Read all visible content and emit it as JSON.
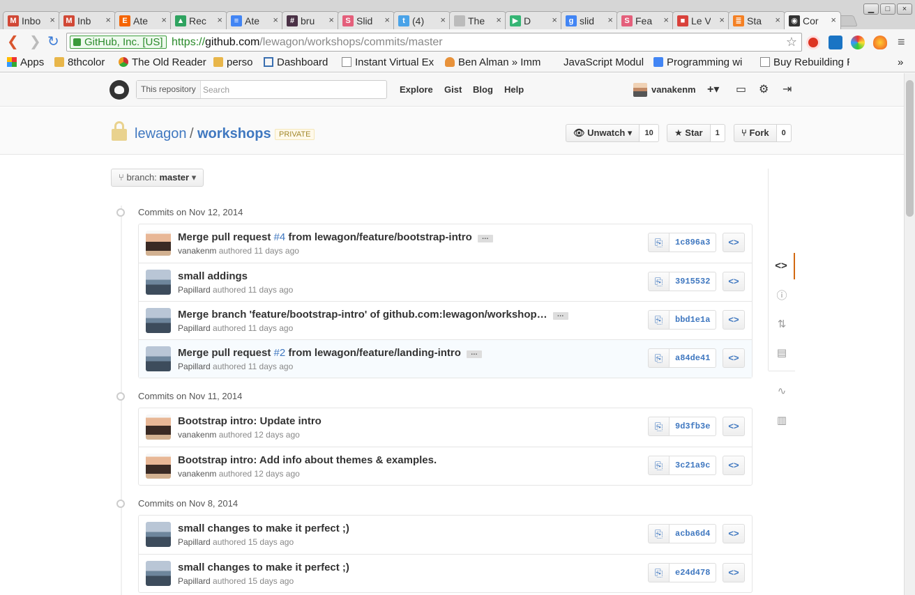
{
  "browser": {
    "tabs": [
      {
        "title": "Inbo",
        "favicon": "gmail-icon",
        "color": "#d14836",
        "glyph": "M"
      },
      {
        "title": "Inb",
        "favicon": "gmail-icon",
        "color": "#d14836",
        "glyph": "M"
      },
      {
        "title": "Ate",
        "favicon": "etsy-icon",
        "color": "#f56400",
        "glyph": "E"
      },
      {
        "title": "Rec",
        "favicon": "drive-icon",
        "color": "#2fa360",
        "glyph": "▲"
      },
      {
        "title": "Ate",
        "favicon": "docs-icon",
        "color": "#4285f4",
        "glyph": "≡"
      },
      {
        "title": "bru",
        "favicon": "slack-icon",
        "color": "#4a3146",
        "glyph": "#"
      },
      {
        "title": "Slid",
        "favicon": "slides-s-icon",
        "color": "#e45f7b",
        "glyph": "S"
      },
      {
        "title": "(4)",
        "favicon": "twitter-icon",
        "color": "#4aa3e8",
        "glyph": "t"
      },
      {
        "title": "The",
        "favicon": "page-icon",
        "color": "#bbbbbb",
        "glyph": ""
      },
      {
        "title": "D",
        "favicon": "play-icon",
        "color": "#35b574",
        "glyph": "▶"
      },
      {
        "title": "slid",
        "favicon": "google-icon",
        "color": "#4285f4",
        "glyph": "g"
      },
      {
        "title": "Fea",
        "favicon": "slides-s-icon",
        "color": "#e45f7b",
        "glyph": "S"
      },
      {
        "title": "Le V",
        "favicon": "wagon-icon",
        "color": "#d9413b",
        "glyph": "■"
      },
      {
        "title": "Sta",
        "favicon": "stack-icon",
        "color": "#f48024",
        "glyph": "≣"
      },
      {
        "title": "Cor",
        "favicon": "github-icon",
        "color": "#333333",
        "glyph": "◉"
      }
    ],
    "ev_label": "GitHub, Inc. [US]",
    "url_scheme": "https://",
    "url_host": "github.com",
    "url_path": "/lewagon/workshops/commits/master",
    "bookmarks": [
      {
        "label": "Apps",
        "icon": "apps-grid-icon"
      },
      {
        "label": "8thcolor",
        "icon": "folder-icon"
      },
      {
        "label": "The Old Reader",
        "icon": "oldreader-icon"
      },
      {
        "label": "perso",
        "icon": "folder-icon"
      },
      {
        "label": "Dashboard",
        "icon": "dashboard-icon"
      },
      {
        "label": "Instant Virtual Ex",
        "icon": "page-icon"
      },
      {
        "label": "Ben Alman » Imm",
        "icon": "ben-icon"
      },
      {
        "label": "JavaScript Modul",
        "icon": "none"
      },
      {
        "label": "Programming wi",
        "icon": "google-icon"
      },
      {
        "label": "Buy Rebuilding R",
        "icon": "page-icon"
      }
    ],
    "bookmarks_more": "»"
  },
  "github": {
    "search_scope": "This repository",
    "search_placeholder": "Search",
    "nav": [
      "Explore",
      "Gist",
      "Blog",
      "Help"
    ],
    "username": "vanakenm",
    "plus_label": "+▾"
  },
  "repo": {
    "owner": "lewagon",
    "slash": "/",
    "name": "workshops",
    "visibility": "PRIVATE",
    "unwatch_label": "Unwatch ▾",
    "watch_count": "10",
    "star_label": "Star",
    "star_count": "1",
    "fork_label": "Fork",
    "fork_count": "0"
  },
  "branch": {
    "label": "branch:",
    "name": "master"
  },
  "commit_days": [
    {
      "title": "Commits on Nov 12, 2014",
      "commits": [
        {
          "pre": "Merge pull request ",
          "pr": "#4",
          "post": " from lewagon/feature/bootstrap-intro",
          "ellipsis": true,
          "author": "vanakenm",
          "avatar": "v",
          "time": "authored 11 days ago",
          "sha": "1c896a3"
        },
        {
          "pre": "small addings",
          "pr": "",
          "post": "",
          "ellipsis": false,
          "author": "Papillard",
          "avatar": "p",
          "time": "authored 11 days ago",
          "sha": "3915532"
        },
        {
          "pre": "Merge branch 'feature/bootstrap-intro' of github.com:lewagon/workshop…",
          "pr": "",
          "post": "",
          "ellipsis": true,
          "author": "Papillard",
          "avatar": "p",
          "time": "authored 11 days ago",
          "sha": "bbd1e1a"
        },
        {
          "pre": "Merge pull request ",
          "pr": "#2",
          "post": " from lewagon/feature/landing-intro",
          "ellipsis": true,
          "author": "Papillard",
          "avatar": "p",
          "time": "authored 11 days ago",
          "sha": "a84de41",
          "highlighted": true
        }
      ]
    },
    {
      "title": "Commits on Nov 11, 2014",
      "commits": [
        {
          "pre": "Bootstrap intro: Update intro",
          "pr": "",
          "post": "",
          "ellipsis": false,
          "author": "vanakenm",
          "avatar": "v",
          "time": "authored 12 days ago",
          "sha": "9d3fb3e"
        },
        {
          "pre": "Bootstrap intro: Add info about themes & examples.",
          "pr": "",
          "post": "",
          "ellipsis": false,
          "author": "vanakenm",
          "avatar": "v",
          "time": "authored 12 days ago",
          "sha": "3c21a9c"
        }
      ]
    },
    {
      "title": "Commits on Nov 8, 2014",
      "commits": [
        {
          "pre": "small changes to make it perfect ;)",
          "pr": "",
          "post": "",
          "ellipsis": false,
          "author": "Papillard",
          "avatar": "p",
          "time": "authored 15 days ago",
          "sha": "acba6d4"
        },
        {
          "pre": "small changes to make it perfect ;)",
          "pr": "",
          "post": "",
          "ellipsis": false,
          "author": "Papillard",
          "avatar": "p",
          "time": "authored 15 days ago",
          "sha": "e24d478"
        }
      ]
    }
  ],
  "repo_nav": [
    "code-icon",
    "issues-icon",
    "pull-requests-icon",
    "wiki-icon",
    "pulse-icon",
    "graphs-icon"
  ],
  "colors": {
    "link": "#4078c0",
    "active_nav": "#d26911",
    "private_badge": "#a1882b"
  }
}
